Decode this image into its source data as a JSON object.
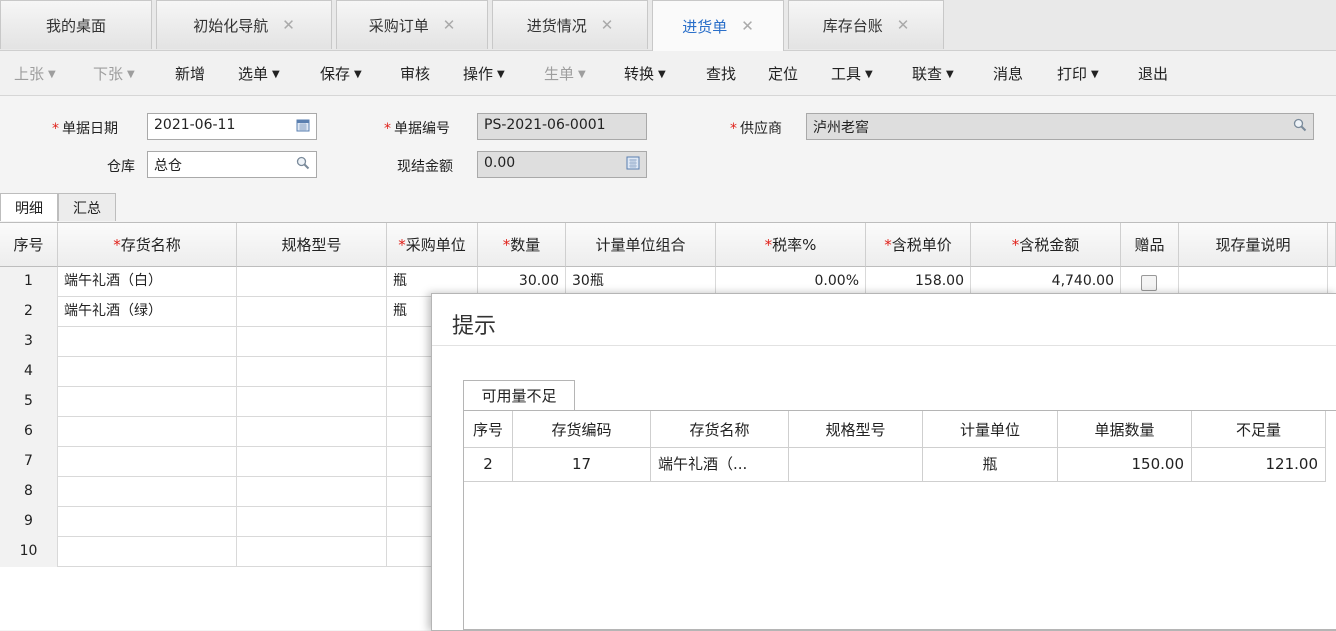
{
  "tabs": [
    {
      "label": "我的桌面",
      "closable": false
    },
    {
      "label": "初始化导航",
      "closable": true
    },
    {
      "label": "采购订单",
      "closable": true
    },
    {
      "label": "进货情况",
      "closable": true
    },
    {
      "label": "进货单",
      "closable": true,
      "active": true
    },
    {
      "label": "库存台账",
      "closable": true
    }
  ],
  "toolbar": {
    "prev": "上张",
    "next": "下张",
    "new": "新增",
    "select": "选单",
    "save": "保存",
    "audit": "审核",
    "operate": "操作",
    "generate": "生单",
    "convert": "转换",
    "find": "查找",
    "locate": "定位",
    "tools": "工具",
    "linked": "联查",
    "message": "消息",
    "print": "打印",
    "exit": "退出"
  },
  "form": {
    "date_label": "单据日期",
    "date_value": "2021-06-11",
    "number_label": "单据编号",
    "number_value": "PS-2021-06-0001",
    "supplier_label": "供应商",
    "supplier_value": "泸州老窖",
    "warehouse_label": "仓库",
    "warehouse_value": "总仓",
    "cash_label": "现结金额",
    "cash_value": "0.00"
  },
  "detail_tabs": {
    "detail": "明细",
    "summary": "汇总"
  },
  "grid": {
    "headers": {
      "seq": "序号",
      "name": "存货名称",
      "spec": "规格型号",
      "unit": "采购单位",
      "qty": "数量",
      "unit_combo": "计量单位组合",
      "tax_rate": "税率%",
      "price": "含税单价",
      "amount": "含税金额",
      "gift": "赠品",
      "stock_note": "现存量说明"
    },
    "rows": [
      {
        "seq": "1",
        "name": "端午礼酒（白）",
        "unit": "瓶",
        "qty": "30.00",
        "unit_combo": "30瓶",
        "tax_rate": "0.00%",
        "price": "158.00",
        "amount": "4,740.00"
      },
      {
        "seq": "2",
        "name": "端午礼酒（绿）",
        "unit": "瓶"
      },
      {
        "seq": "3"
      },
      {
        "seq": "4"
      },
      {
        "seq": "5"
      },
      {
        "seq": "6"
      },
      {
        "seq": "7"
      },
      {
        "seq": "8"
      },
      {
        "seq": "9"
      },
      {
        "seq": "10"
      }
    ]
  },
  "dialog": {
    "title": "提示",
    "tab": "可用量不足",
    "headers": {
      "seq": "序号",
      "code": "存货编码",
      "name": "存货名称",
      "spec": "规格型号",
      "unit": "计量单位",
      "doc_qty": "单据数量",
      "shortage": "不足量"
    },
    "row": {
      "seq": "2",
      "code": "17",
      "name": "端午礼酒（...",
      "spec": "",
      "unit": "瓶",
      "doc_qty": "150.00",
      "shortage": "121.00"
    }
  },
  "colors": {
    "accent": "#2a6fc9",
    "required": "#e0211a"
  }
}
